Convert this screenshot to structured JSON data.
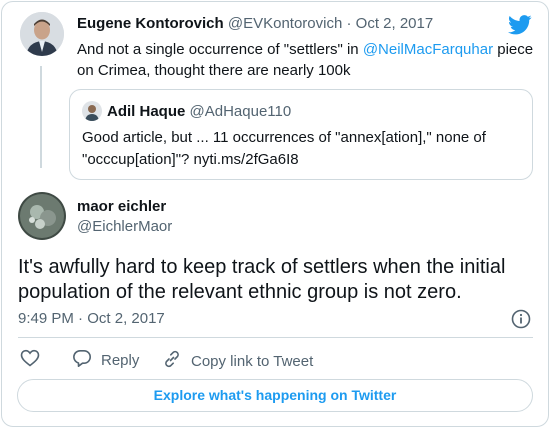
{
  "reply": {
    "name": "Eugene Kontorovich",
    "handle": "@EVKontorovich",
    "separator": "·",
    "date": "Oct 2, 2017",
    "text_before_mention": "And not a single occurrence of \"settlers\" in ",
    "mention": "@NeilMacFarquhar",
    "text_after_mention_line1": " piece",
    "text_line2": "on Crimea, thought there are nearly 100k"
  },
  "quoted": {
    "name": "Adil Haque",
    "handle": "@AdHaque110",
    "line1": "Good article, but ... 11 occurrences of \"annex[ation],\" none of",
    "line2": "\"occcup[ation]\"? nyti.ms/2fGa6I8"
  },
  "main": {
    "name": "maor eichler",
    "handle": "@EichlerMaor",
    "line1": "It's awfully hard to keep track of settlers when the initial",
    "line2": "population of the relevant ethnic group is not zero.",
    "time": "9:49 PM",
    "separator": "·",
    "date": "Oct 2, 2017"
  },
  "actions": {
    "reply": "Reply",
    "copy_link": "Copy link to Tweet",
    "explore": "Explore what's happening on Twitter"
  },
  "colors": {
    "twitter_blue": "#1d9bf0",
    "muted": "#536471",
    "border": "#cfd9de"
  },
  "icons": [
    "twitter-bird-icon",
    "info-icon",
    "heart-icon",
    "reply-icon",
    "link-icon"
  ]
}
